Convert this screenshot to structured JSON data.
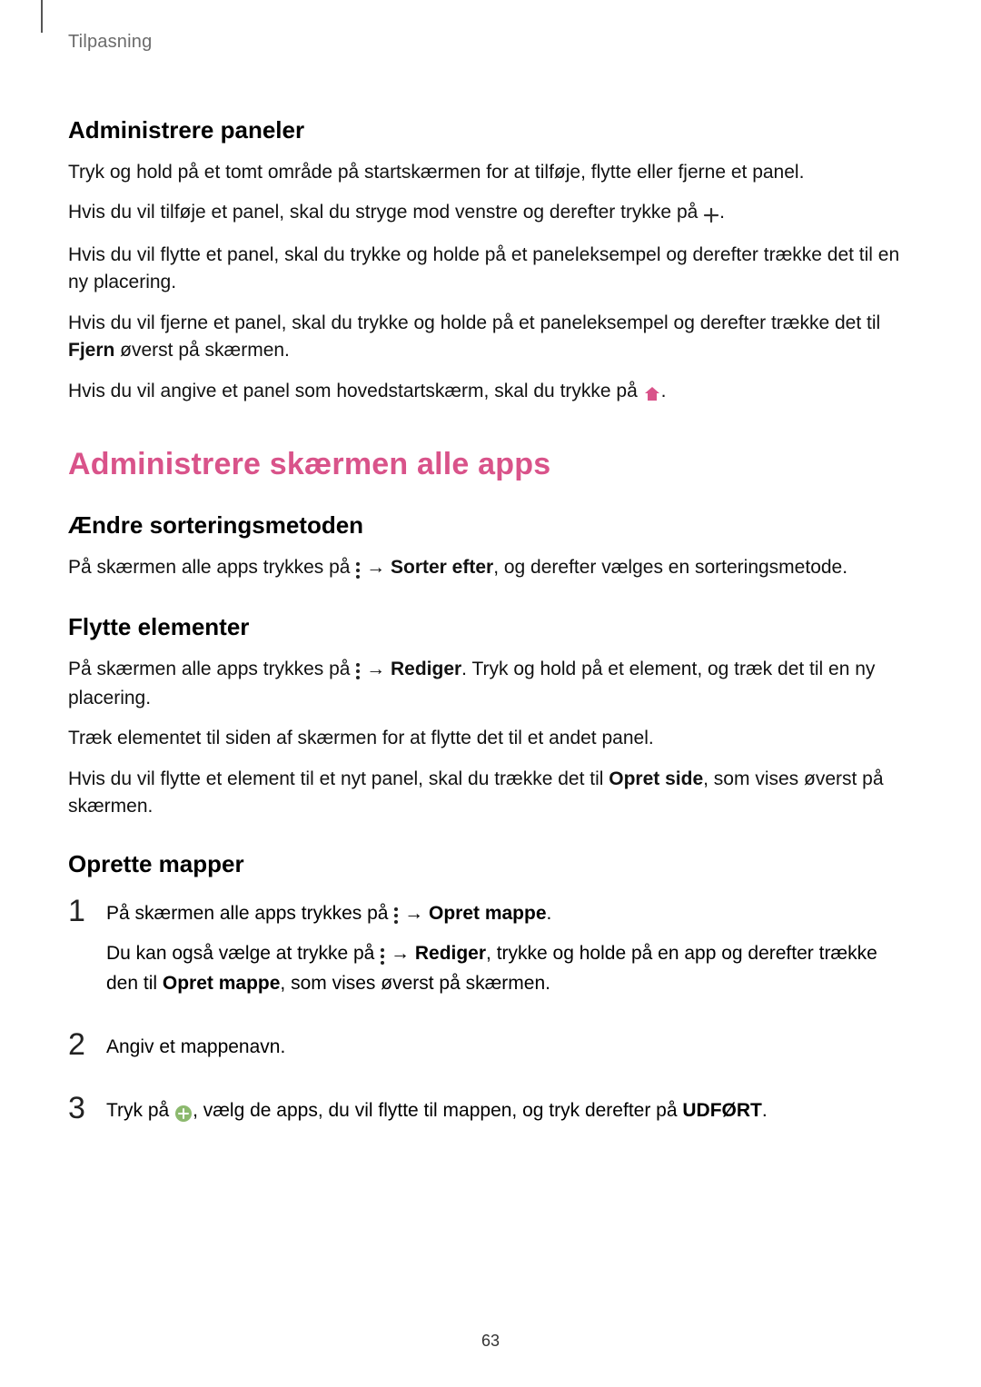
{
  "breadcrumb": "Tilpasning",
  "page_number": "63",
  "section1": {
    "heading": "Administrere paneler",
    "p1": "Tryk og hold på et tomt område på startskærmen for at tilføje, flytte eller fjerne et panel.",
    "p2_a": "Hvis du vil tilføje et panel, skal du stryge mod venstre og derefter trykke på ",
    "p2_b": ".",
    "p3": "Hvis du vil flytte et panel, skal du trykke og holde på et paneleksempel og derefter trække det til en ny placering.",
    "p4_a": "Hvis du vil fjerne et panel, skal du trykke og holde på et paneleksempel og derefter trække det til ",
    "p4_bold": "Fjern",
    "p4_b": " øverst på skærmen.",
    "p5_a": "Hvis du vil angive et panel som hovedstartskærm, skal du trykke på ",
    "p5_b": "."
  },
  "section2": {
    "heading": "Administrere skærmen alle apps",
    "sub1": {
      "heading": "Ændre sorteringsmetoden",
      "p1_a": "På skærmen alle apps trykkes på ",
      "p1_arrow": " → ",
      "p1_bold": "Sorter efter",
      "p1_b": ", og derefter vælges en sorteringsmetode."
    },
    "sub2": {
      "heading": "Flytte elementer",
      "p1_a": "På skærmen alle apps trykkes på ",
      "p1_arrow": " → ",
      "p1_bold": "Rediger",
      "p1_b": ". Tryk og hold på et element, og træk det til en ny placering.",
      "p2": "Træk elementet til siden af skærmen for at flytte det til et andet panel.",
      "p3_a": "Hvis du vil flytte et element til et nyt panel, skal du trække det til ",
      "p3_bold": "Opret side",
      "p3_b": ", som vises øverst på skærmen."
    },
    "sub3": {
      "heading": "Oprette mapper",
      "step1": {
        "a": "På skærmen alle apps trykkes på ",
        "arrow": " → ",
        "bold1": "Opret mappe",
        "b": ".",
        "c": "Du kan også vælge at trykke på ",
        "arrow2": " → ",
        "bold2": "Rediger",
        "d": ", trykke og holde på en app og derefter trække den til ",
        "bold3": "Opret mappe",
        "e": ", som vises øverst på skærmen."
      },
      "step2": "Angiv et mappenavn.",
      "step3": {
        "a": "Tryk på ",
        "b": ", vælg de apps, du vil flytte til mappen, og tryk derefter på ",
        "bold": "UDFØRT",
        "c": "."
      }
    }
  },
  "nums": {
    "n1": "1",
    "n2": "2",
    "n3": "3"
  }
}
